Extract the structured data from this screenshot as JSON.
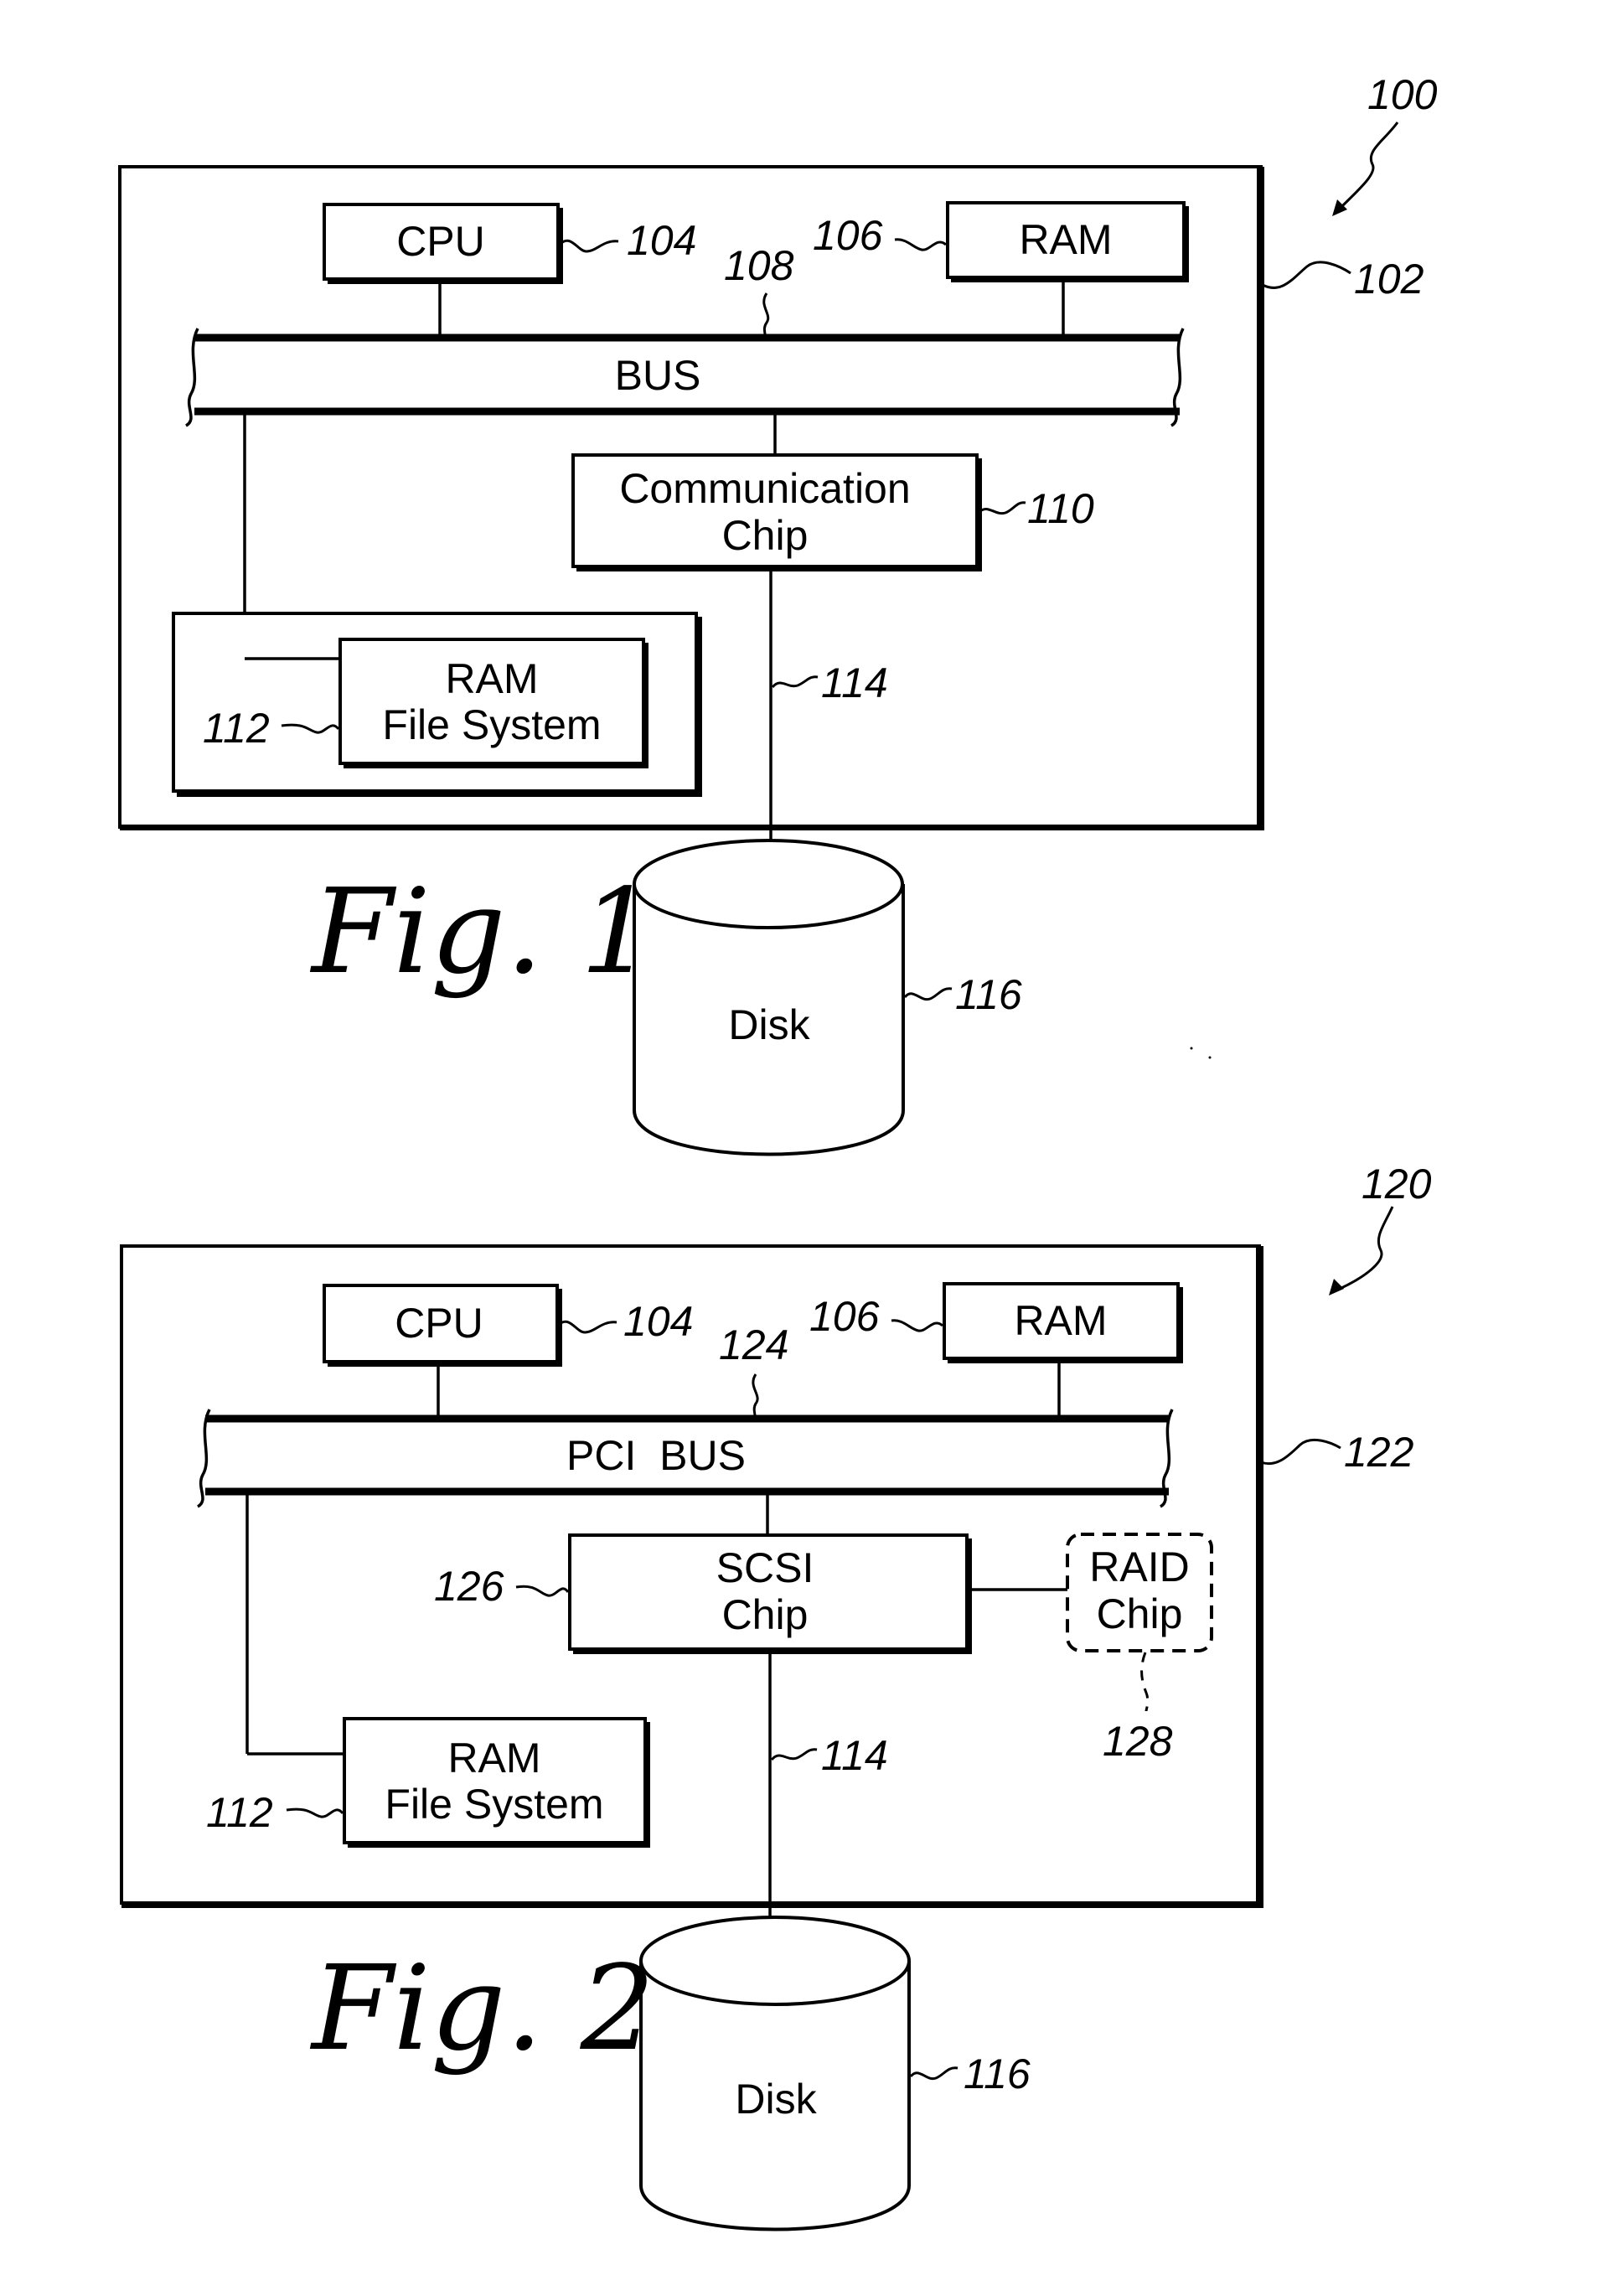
{
  "figures": [
    {
      "id": "fig1",
      "caption": "Fig. 1",
      "system_ref": "100",
      "board_ref": "102",
      "cpu": {
        "label": "CPU",
        "ref": "104"
      },
      "ram": {
        "label": "RAM",
        "ref": "106"
      },
      "bus": {
        "label": "BUS",
        "ref": "108"
      },
      "chip": {
        "label_line1": "Communication",
        "label_line2": "Chip",
        "ref": "110"
      },
      "ramfs": {
        "label_line1": "RAM",
        "label_line2": "File System",
        "ref": "112"
      },
      "link": {
        "ref": "114"
      },
      "disk": {
        "label": "Disk",
        "ref": "116"
      }
    },
    {
      "id": "fig2",
      "caption": "Fig. 2",
      "system_ref": "120",
      "board_ref": "122",
      "cpu": {
        "label": "CPU",
        "ref": "104"
      },
      "ram": {
        "label": "RAM",
        "ref": "106"
      },
      "bus": {
        "label": "PCI  BUS",
        "ref": "124"
      },
      "chip": {
        "label_line1": "SCSI",
        "label_line2": "Chip",
        "ref": "126"
      },
      "raid": {
        "label_line1": "RAID",
        "label_line2": "Chip",
        "ref": "128",
        "optional": true
      },
      "ramfs": {
        "label_line1": "RAM",
        "label_line2": "File System",
        "ref": "112"
      },
      "link": {
        "ref": "114"
      },
      "disk": {
        "label": "Disk",
        "ref": "116"
      }
    }
  ]
}
